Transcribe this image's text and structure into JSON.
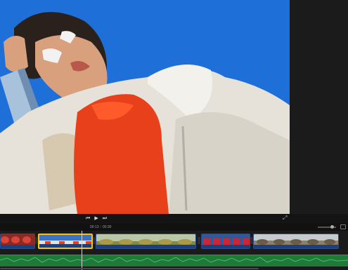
{
  "player": {
    "prev_icon": "skip-back-icon",
    "play_icon": "play-icon",
    "next_icon": "skip-forward-icon",
    "prev_glyph": "⏮",
    "play_glyph": "▶",
    "next_glyph": "⏭",
    "fullscreen_glyph": "⤢"
  },
  "timeline": {
    "current_time": "00:13",
    "total_time": "00:30",
    "separator": "/"
  },
  "colors": {
    "sky": "#1f6fd8",
    "jacket": "#e8e4dc",
    "sweater": "#e8401a",
    "selection": "#f5c518",
    "audio": "#1f7a3a"
  }
}
